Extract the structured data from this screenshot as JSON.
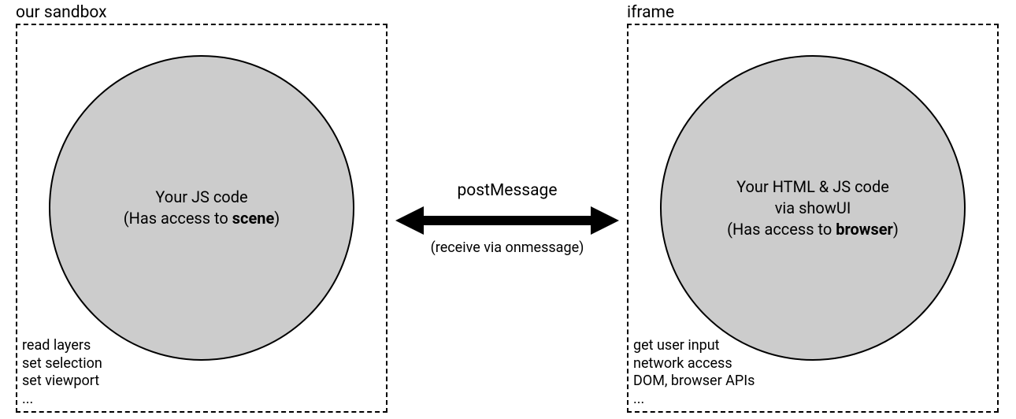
{
  "left": {
    "label": "our sandbox",
    "circle_line1": "Your JS code",
    "circle_line2_prefix": "(Has access to ",
    "circle_line2_bold": "scene",
    "circle_line2_suffix": ")",
    "cap1": "read layers",
    "cap2": "set selection",
    "cap3": "set viewport",
    "cap4": "..."
  },
  "center": {
    "title": "postMessage",
    "subtitle": "(receive via onmessage)"
  },
  "right": {
    "label": "iframe",
    "circle_line1": "Your  HTML & JS code",
    "circle_line2": "via showUI",
    "circle_line3_prefix": "(Has access to ",
    "circle_line3_bold": "browser",
    "circle_line3_suffix": ")",
    "cap1": "get user input",
    "cap2": "network access",
    "cap3": "DOM, browser APIs",
    "cap4": "..."
  }
}
